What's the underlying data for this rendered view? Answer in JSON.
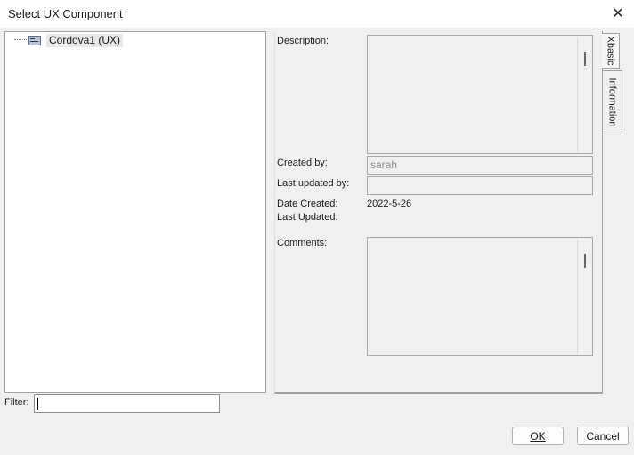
{
  "window": {
    "title": "Select UX Component",
    "close_symbol": "✕"
  },
  "tree": {
    "items": [
      {
        "label": "Cordova1 (UX)",
        "icon": "ux-component-icon"
      }
    ]
  },
  "filter": {
    "label": "Filter:",
    "value": ""
  },
  "info": {
    "description_label": "Description:",
    "created_by_label": "Created by:",
    "created_by_value": "sarah",
    "last_updated_by_label": "Last updated by:",
    "last_updated_by_value": "",
    "date_created_label": "Date Created:",
    "date_created_value": "2022-5-26",
    "last_updated_label": "Last Updated:",
    "last_updated_value": "",
    "comments_label": "Comments:"
  },
  "tabs": [
    {
      "label": "Xbasic"
    },
    {
      "label": "Information"
    }
  ],
  "buttons": {
    "ok_label": "OK",
    "cancel_label": "Cancel"
  }
}
